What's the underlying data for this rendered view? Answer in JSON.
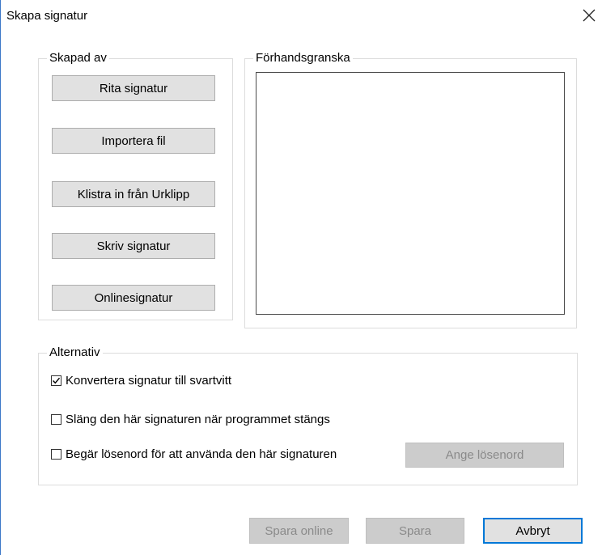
{
  "window": {
    "title": "Skapa signatur",
    "close_glyph": "✕"
  },
  "created_by": {
    "label": "Skapad av",
    "buttons": [
      "Rita signatur",
      "Importera fil",
      "Klistra in från Urklipp",
      "Skriv signatur",
      "Onlinesignatur"
    ]
  },
  "preview": {
    "label": "Förhandsgranska"
  },
  "options": {
    "label": "Alternativ",
    "checkboxes": [
      {
        "label": "Konvertera signatur till svartvitt",
        "checked": true
      },
      {
        "label": "Släng den här signaturen när programmet stängs",
        "checked": false
      },
      {
        "label": "Begär lösenord för att använda den här signaturen",
        "checked": false
      }
    ],
    "password_button": "Ange lösenord"
  },
  "footer": {
    "save_online": "Spara online",
    "save": "Spara",
    "cancel": "Avbryt"
  },
  "colors": {
    "accent": "#0078d7",
    "button_bg": "#e1e1e1",
    "disabled_bg": "#cccccc",
    "disabled_text": "#8a8a8a"
  }
}
